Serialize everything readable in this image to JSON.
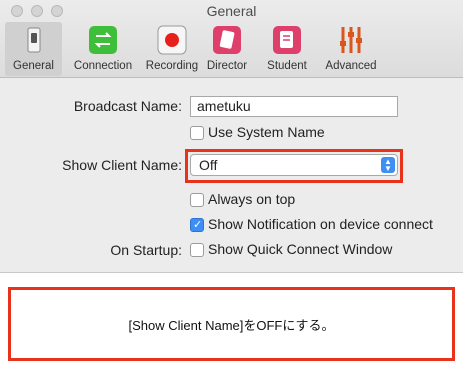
{
  "window": {
    "title": "General"
  },
  "toolbar": {
    "items": [
      {
        "label": "General",
        "icon": "light-switch-icon",
        "selected": true
      },
      {
        "label": "Connection",
        "icon": "arrows-exchange-icon"
      },
      {
        "label": "Recording",
        "icon": "record-icon"
      },
      {
        "label": "Director",
        "icon": "director-icon"
      },
      {
        "label": "Student",
        "icon": "student-icon"
      },
      {
        "label": "Advanced",
        "icon": "sliders-icon"
      }
    ]
  },
  "form": {
    "broadcast_name_label": "Broadcast Name:",
    "broadcast_name_value": "ametuku",
    "use_system_name": {
      "label": "Use System Name",
      "checked": false
    },
    "show_client_name_label": "Show Client Name:",
    "show_client_name_value": "Off",
    "always_on_top": {
      "label": "Always on top",
      "checked": false
    },
    "show_notification": {
      "label": "Show Notification on device connect",
      "checked": true
    },
    "on_startup_label": "On Startup:",
    "show_quick_connect": {
      "label": "Show Quick Connect Window",
      "checked": false
    }
  },
  "caption": "[Show Client Name]をOFFにする。",
  "colors": {
    "highlight": "#e8321b",
    "accent": "#3d8ff6"
  }
}
